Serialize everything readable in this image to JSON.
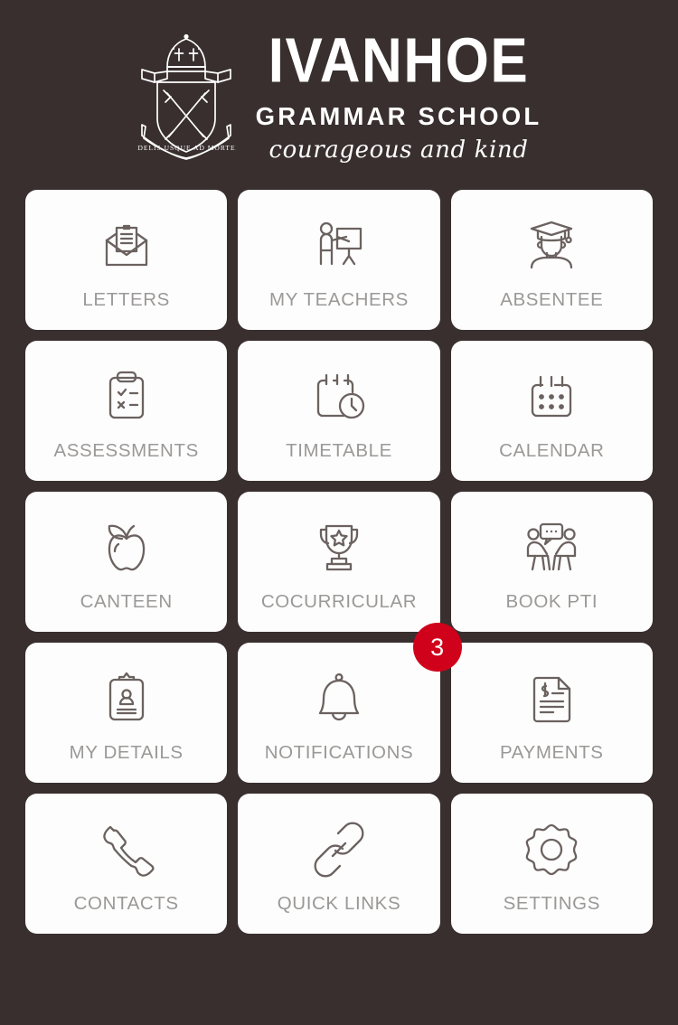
{
  "header": {
    "crest_icon": "school-crest-icon",
    "crest_motto": "FIDELIS USQUE AD MORTEM",
    "wordmark_main": "IVANHOE",
    "wordmark_sub": "GRAMMAR SCHOOL",
    "tagline": "courageous and kind"
  },
  "colors": {
    "background": "#382F2E",
    "tile_background": "#FDFDFD",
    "tile_label": "#9B9997",
    "tile_icon": "#6B6260",
    "badge_background": "#D0021B",
    "badge_text": "#FFFFFF",
    "wordmark": "#FFFFFF"
  },
  "grid": {
    "columns": 3,
    "tiles": [
      {
        "label": "LETTERS",
        "icon": "envelope-letter-icon"
      },
      {
        "label": "MY TEACHERS",
        "icon": "teacher-whiteboard-icon"
      },
      {
        "label": "ABSENTEE",
        "icon": "graduate-student-icon"
      },
      {
        "label": "ASSESSMENTS",
        "icon": "clipboard-checklist-icon"
      },
      {
        "label": "TIMETABLE",
        "icon": "calendar-clock-icon"
      },
      {
        "label": "CALENDAR",
        "icon": "calendar-dots-icon"
      },
      {
        "label": "CANTEEN",
        "icon": "apple-icon"
      },
      {
        "label": "COCURRICULAR",
        "icon": "trophy-star-icon"
      },
      {
        "label": "BOOK PTI",
        "icon": "interview-chat-icon"
      },
      {
        "label": "MY DETAILS",
        "icon": "clipboard-profile-icon"
      },
      {
        "label": "NOTIFICATIONS",
        "icon": "bell-icon",
        "badge": "3"
      },
      {
        "label": "PAYMENTS",
        "icon": "invoice-dollar-icon"
      },
      {
        "label": "CONTACTS",
        "icon": "phone-handset-icon"
      },
      {
        "label": "QUICK LINKS",
        "icon": "chain-link-icon"
      },
      {
        "label": "SETTINGS",
        "icon": "gear-icon"
      }
    ]
  }
}
